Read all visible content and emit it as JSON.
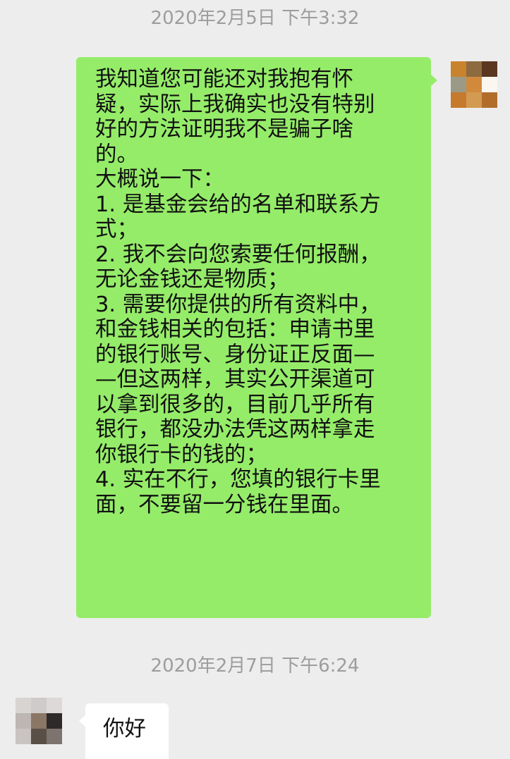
{
  "chat": {
    "timestamp_1": "2020年2月5日 下午3:32",
    "timestamp_2": "2020年2月7日 下午6:24",
    "outgoing_message": {
      "lines": [
        "我知道您可能还对我抱有怀",
        "疑，实际上我确实也没有特别",
        "好的方法证明我不是骗子啥",
        "的。",
        "大概说一下：",
        "1. 是基金会给的名单和联系方",
        "式；",
        "2. 我不会向您索要任何报酬，",
        "无论金钱还是物质；",
        "3. 需要你提供的所有资料中，",
        "和金钱相关的包括：申请书里",
        "的银行账号、身份证正反面—",
        "—但这两样，其实公开渠道可",
        "以拿到很多的，目前几乎所有",
        "银行，都没办法凭这两样拿走",
        "你银行卡的钱的；",
        "4. 实在不行，您填的银行卡里",
        "面，不要留一分钱在里面。"
      ]
    },
    "incoming_message": {
      "text": "你好"
    }
  },
  "colors": {
    "background": "#ededed",
    "outgoing_bubble": "#95ec69",
    "incoming_bubble": "#ffffff",
    "timestamp_text": "#9d9d9d"
  },
  "avatars": {
    "self_avatar_icon": "pixelated-avatar-icon",
    "contact_avatar_icon": "pixelated-avatar-icon"
  }
}
